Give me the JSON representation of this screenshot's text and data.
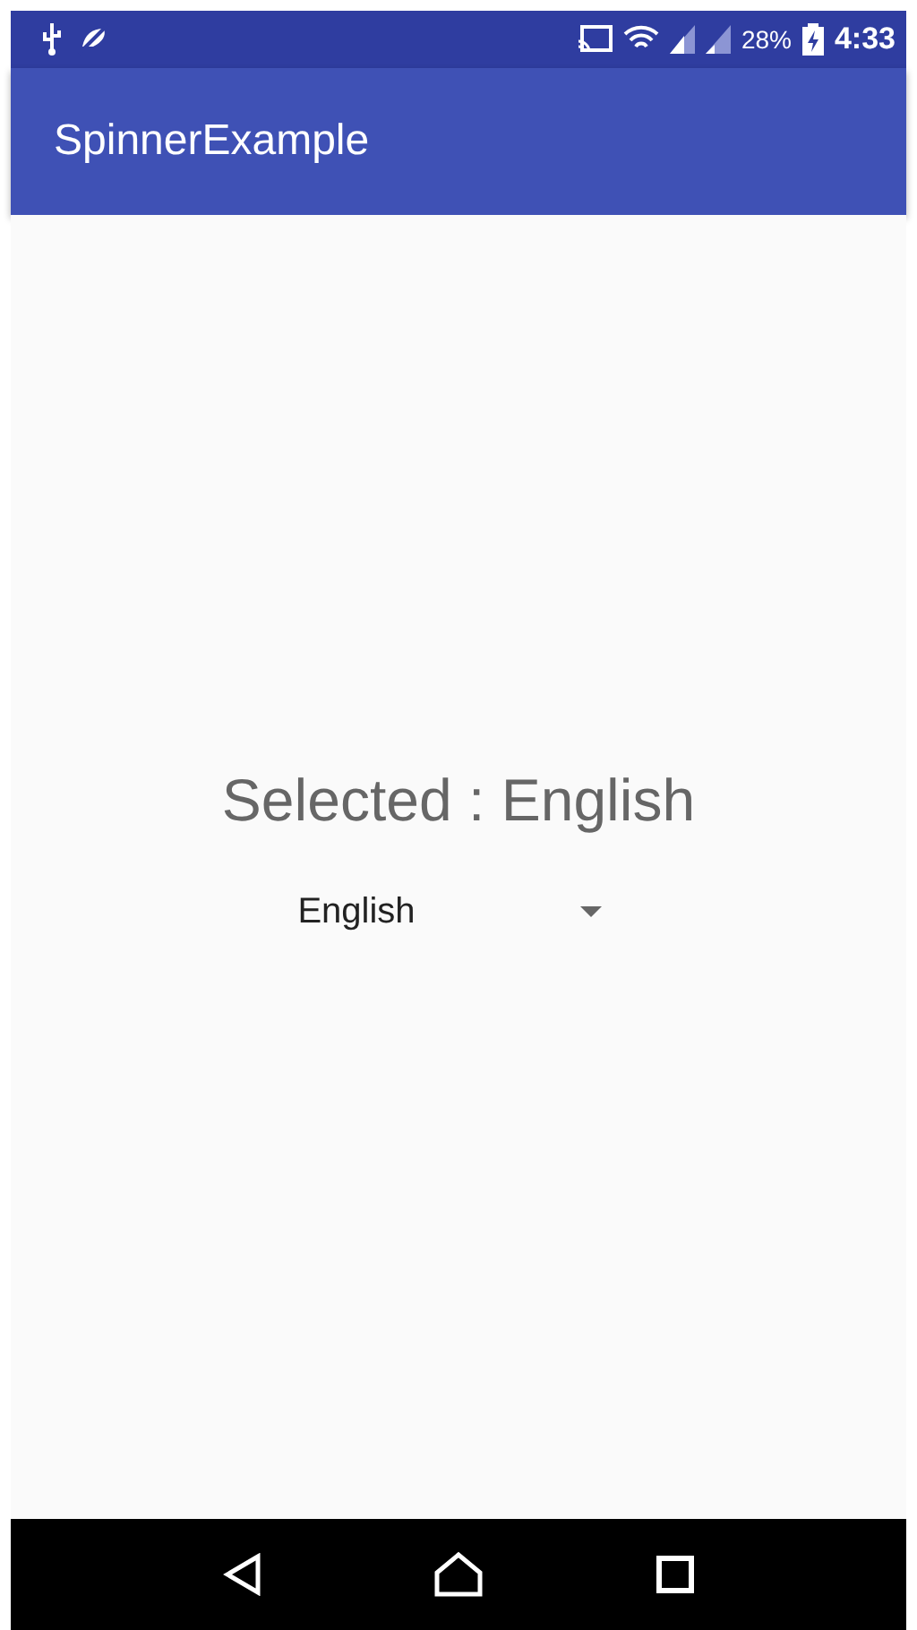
{
  "status_bar": {
    "battery": "28%",
    "time": "4:33"
  },
  "app_bar": {
    "title": "SpinnerExample"
  },
  "content": {
    "selected_text": "Selected : English",
    "spinner": {
      "value": "English"
    }
  }
}
